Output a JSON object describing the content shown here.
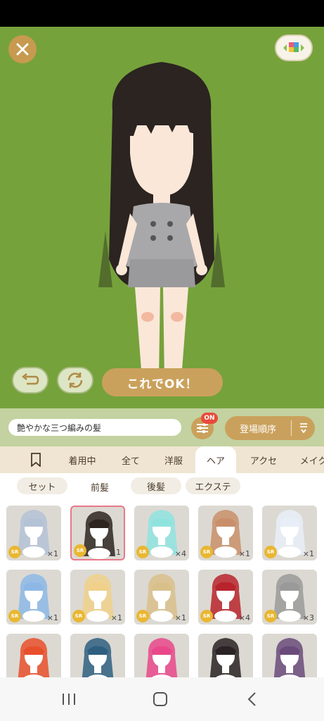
{
  "colors": {
    "stage_bg": "#76a23b",
    "accent_gold": "#caa15c",
    "selected_border": "#e87888",
    "badge_on": "#e84a3a",
    "sr_badge": "#e9b731"
  },
  "stage": {
    "confirm_label": "これでOK！",
    "icons": [
      "close-icon",
      "background-color-icon",
      "undo-icon",
      "rotate-icon"
    ]
  },
  "filter": {
    "search_value": "艶やかな三つ編みの髪",
    "badge": "ON",
    "sort_label": "登場順序"
  },
  "categories": {
    "tabs": [
      "着用中",
      "全て",
      "洋服",
      "ヘア",
      "アクセ",
      "メイク"
    ],
    "active": "ヘア"
  },
  "subcategories": {
    "tabs": [
      "セット",
      "前髪",
      "後髪",
      "エクステ"
    ],
    "active": "前髪"
  },
  "items": [
    {
      "rarity": "SR",
      "qty": "×1",
      "hair": "#b4c2d6",
      "selected": false
    },
    {
      "rarity": "SR",
      "qty": "×1",
      "hair": "#2d2420",
      "selected": true
    },
    {
      "rarity": "SR",
      "qty": "×4",
      "hair": "#8fe3df",
      "selected": false
    },
    {
      "rarity": "SR",
      "qty": "×1",
      "hair": "#c98f6a",
      "selected": false
    },
    {
      "rarity": "SR",
      "qty": "×1",
      "hair": "#e8eef7",
      "selected": false
    },
    {
      "rarity": "SR",
      "qty": "×1",
      "hair": "#8db8e6",
      "selected": false
    },
    {
      "rarity": "SR",
      "qty": "×1",
      "hair": "#f0d08a",
      "selected": false
    },
    {
      "rarity": "SR",
      "qty": "×1",
      "hair": "#d9c08b",
      "selected": false
    },
    {
      "rarity": "SR",
      "qty": "×4",
      "hair": "#b8242c",
      "selected": false
    },
    {
      "rarity": "SR",
      "qty": "×3",
      "hair": "#9a9a9a",
      "selected": false
    },
    {
      "rarity": "",
      "qty": "",
      "hair": "#e8502c",
      "selected": false
    },
    {
      "rarity": "",
      "qty": "",
      "hair": "#2f5f80",
      "selected": false
    },
    {
      "rarity": "",
      "qty": "",
      "hair": "#e8488a",
      "selected": false
    },
    {
      "rarity": "",
      "qty": "",
      "hair": "#2a2224",
      "selected": false
    },
    {
      "rarity": "",
      "qty": "",
      "hair": "#6a4a7a",
      "selected": false
    }
  ]
}
